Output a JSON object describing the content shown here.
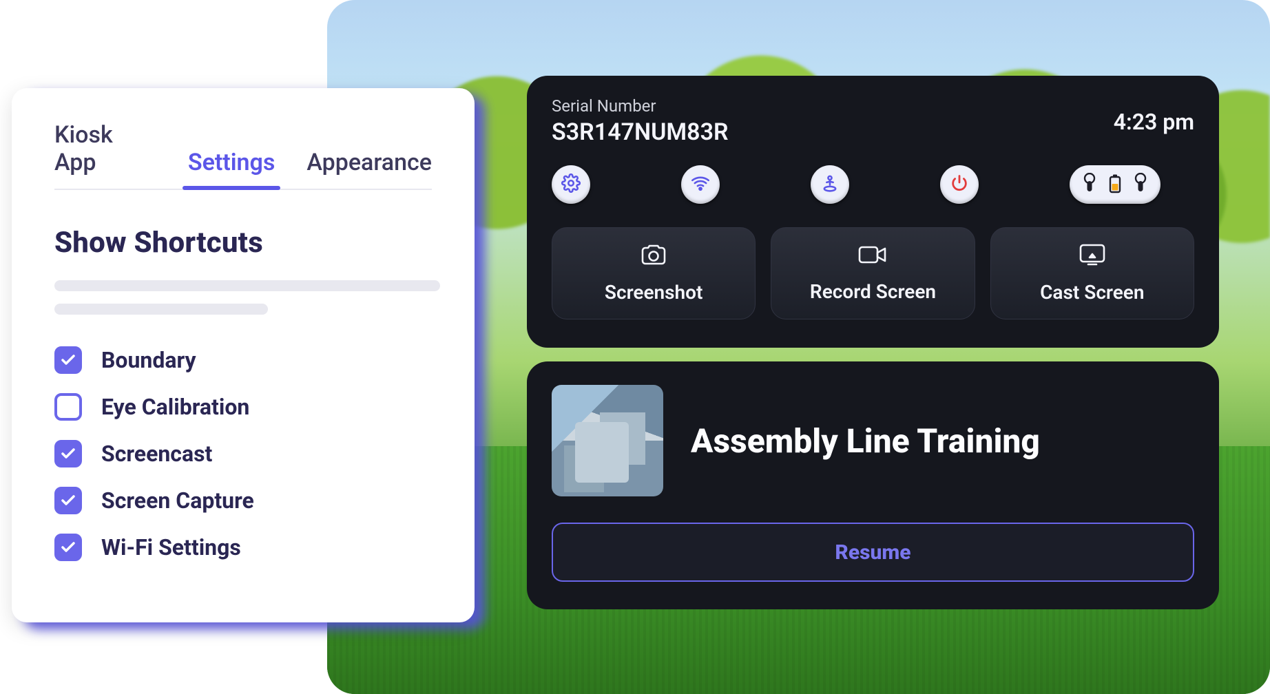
{
  "settings": {
    "tabs": [
      {
        "label": "Kiosk App",
        "active": false
      },
      {
        "label": "Settings",
        "active": true
      },
      {
        "label": "Appearance",
        "active": false
      }
    ],
    "section_title": "Show Shortcuts",
    "shortcuts": [
      {
        "label": "Boundary",
        "checked": true
      },
      {
        "label": "Eye Calibration",
        "checked": false
      },
      {
        "label": "Screencast",
        "checked": true
      },
      {
        "label": "Screen Capture",
        "checked": true
      },
      {
        "label": "Wi-Fi Settings",
        "checked": true
      }
    ]
  },
  "vr": {
    "serial_label": "Serial Number",
    "serial_value": "S3R147NUM83R",
    "clock": "4:23 pm",
    "icons": [
      {
        "name": "settings-icon"
      },
      {
        "name": "wifi-icon"
      },
      {
        "name": "boundary-icon"
      },
      {
        "name": "power-icon"
      }
    ],
    "actions": [
      {
        "label": "Screenshot",
        "icon": "camera-icon"
      },
      {
        "label": "Record Screen",
        "icon": "video-icon"
      },
      {
        "label": "Cast Screen",
        "icon": "cast-icon"
      }
    ],
    "app": {
      "title": "Assembly Line Training",
      "resume_label": "Resume"
    }
  }
}
